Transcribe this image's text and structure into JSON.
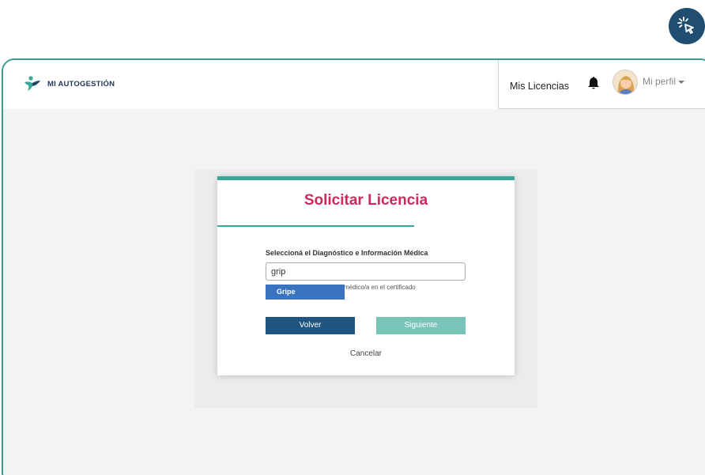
{
  "header": {
    "brand": "MI AUTOGESTIÓN",
    "nav_link": "Mis Licencias",
    "profile_label": "Mi perfil"
  },
  "dialog": {
    "title": "Solicitar Licencia",
    "field_label": "Seleccioná el Diagnóstico e Información Médica",
    "input_value": "grip",
    "hint": "médico/a en el certificado",
    "suggestion": "Gripe",
    "back_label": "Volver",
    "next_label": "Siguiente",
    "cancel_label": "Cancelar"
  },
  "colors": {
    "accent_teal": "#3aa79a",
    "title_pink": "#d0285a",
    "primary_blue": "#1f5580",
    "suggestion_blue": "#3a73c0",
    "next_disabled": "#79c4b8"
  },
  "icons": [
    "click-icon",
    "brand-logo-icon",
    "bell-icon",
    "avatar",
    "caret-down-icon"
  ]
}
